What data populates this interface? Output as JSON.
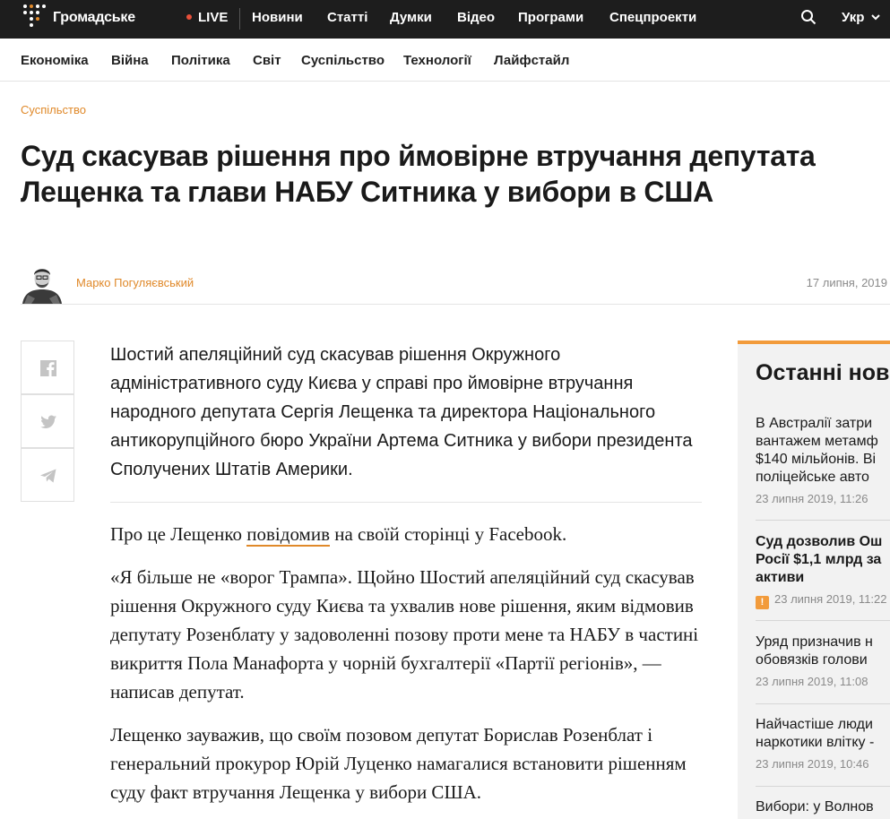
{
  "brand": {
    "name": "Громадське"
  },
  "topbar": {
    "live": "LIVE",
    "nav": [
      "Новини",
      "Статті",
      "Думки",
      "Відео",
      "Програми",
      "Спецпроекти"
    ],
    "lang": "Укр"
  },
  "subnav": [
    "Економіка",
    "Війна",
    "Політика",
    "Світ",
    "Суспільство",
    "Технології",
    "Лайфстайл"
  ],
  "article": {
    "category": "Суспільство",
    "title": "Суд скасував рішення про ймовірне втручання депутата Лещенка та глави НАБУ Ситника у вибори в США",
    "author": "Марко Погуляєвський",
    "date": "17 липня, 2019",
    "lead": "Шостий апеляційний суд скасував рішення Окружного адміністративного суду Києва у справі про ймовірне втручання народного депутата Сергія Лещенка та директора Національного антикорупційного бюро України Артема Ситника у вибори президента Сполучених Штатів Америки.",
    "p1_before": "Про це Лещенко ",
    "p1_link": "повідомив",
    "p1_after": " на своїй сторінці у Facebook.",
    "p2": "«Я більше не «ворог Трампа». Щойно Шостий апеляційний суд скасував рішення Окружного суду Києва та ухвалив нове рішення, яким відмовив депутату Розенблату у задоволенні позову проти мене та НАБУ в частині викриття Пола Манафорта у чорній бухгалтерії «Партії регіонів», — написав депутат.",
    "p3": "Лещенко зауважив, що своїм позовом депутат Борислав Розенблат і генеральний прокурор Юрій Луценко намагалися встановити рішенням суду факт втручання Лещенка у вибори США."
  },
  "share": [
    "facebook-icon",
    "twitter-icon",
    "telegram-icon"
  ],
  "sidebar": {
    "title": "Останні нов",
    "news": [
      {
        "lines": [
          "В Австралії затри",
          "вантажем метамф",
          "$140 мільйонів. Ві",
          "поліцейське авто"
        ],
        "time": "23 липня 2019, 11:26",
        "bold": false,
        "warn": false
      },
      {
        "lines": [
          "Суд дозволив Ош",
          "Росії $1,1 млрд за",
          "активи"
        ],
        "time": "23 липня 2019, 11:22",
        "bold": true,
        "warn": true
      },
      {
        "lines": [
          "Уряд призначив н",
          "обовязків голови"
        ],
        "time": "23 липня 2019, 11:08",
        "bold": false,
        "warn": false
      },
      {
        "lines": [
          "Найчастіше люди",
          "наркотики влітку -"
        ],
        "time": "23 липня 2019, 10:46",
        "bold": false,
        "warn": false
      },
      {
        "lines": [
          "Вибори: у Волнов"
        ],
        "time": "",
        "bold": false,
        "warn": false
      }
    ]
  },
  "colors": {
    "accent": "#e0892a",
    "topbar": "#1d1d1d",
    "live": "#e8503a"
  }
}
